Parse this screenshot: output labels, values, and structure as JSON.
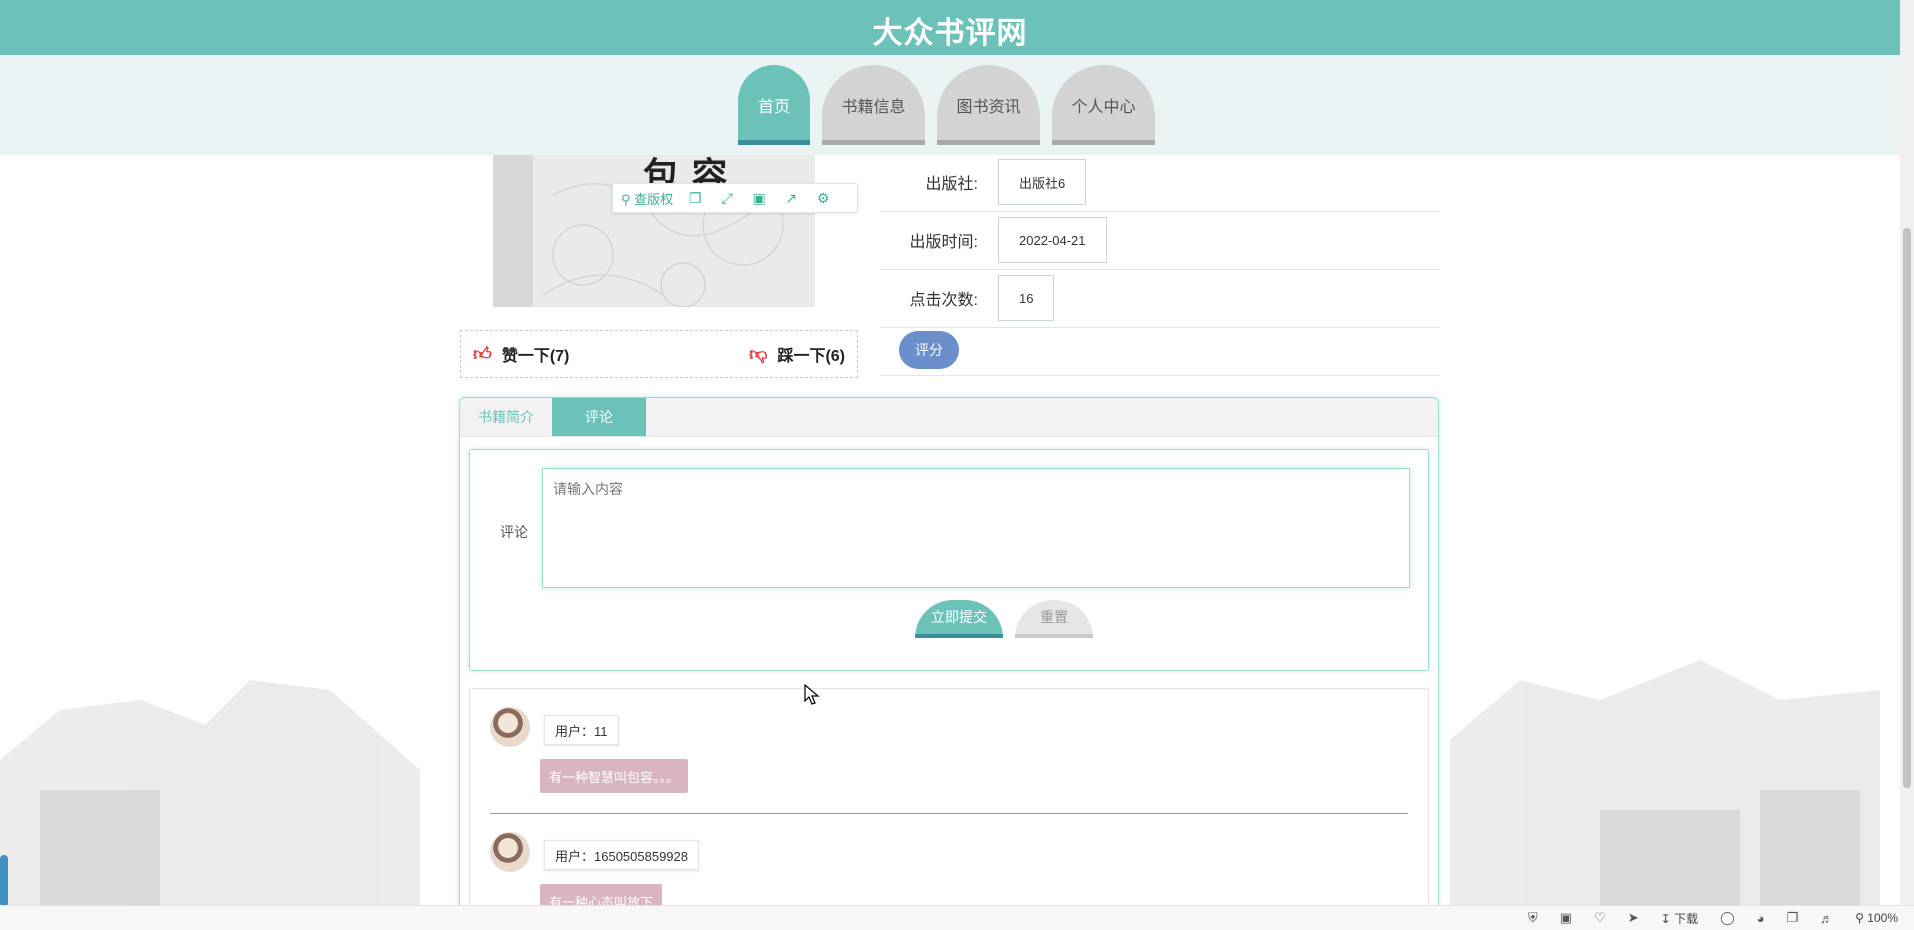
{
  "site": {
    "title": "大众书评网"
  },
  "nav": {
    "tabs": [
      "首页",
      "书籍信息",
      "图书资讯",
      "个人中心"
    ]
  },
  "cover": {
    "title_glyph": "包 容"
  },
  "image_toolbar": {
    "copyright_label": "查版权"
  },
  "votes": {
    "like_label": "赞一下(7)",
    "dislike_label": "踩一下(6)"
  },
  "book_info": [
    {
      "label": "出版社:",
      "value": "出版社6"
    },
    {
      "label": "出版时间:",
      "value": "2022-04-21"
    },
    {
      "label": "点击次数:",
      "value": "16"
    }
  ],
  "rate_button": "评分",
  "tabs": {
    "intro": "书籍简介",
    "comments": "评论"
  },
  "comment_form": {
    "label": "评论",
    "placeholder": "请输入内容",
    "submit": "立即提交",
    "reset": "重置"
  },
  "comments": [
    {
      "user": "用户：11",
      "text": "有一种智慧叫包容。。。"
    },
    {
      "user": "用户：1650505859928",
      "text": "有一种心态叫放下"
    }
  ],
  "status_bar": {
    "download": "下载",
    "zoom": "100%"
  },
  "colors": {
    "primary": "#6cc2b8",
    "accent_dark": "#3b8e9a",
    "rate": "#6b8fcb",
    "bubble": "#d9b5bf"
  }
}
